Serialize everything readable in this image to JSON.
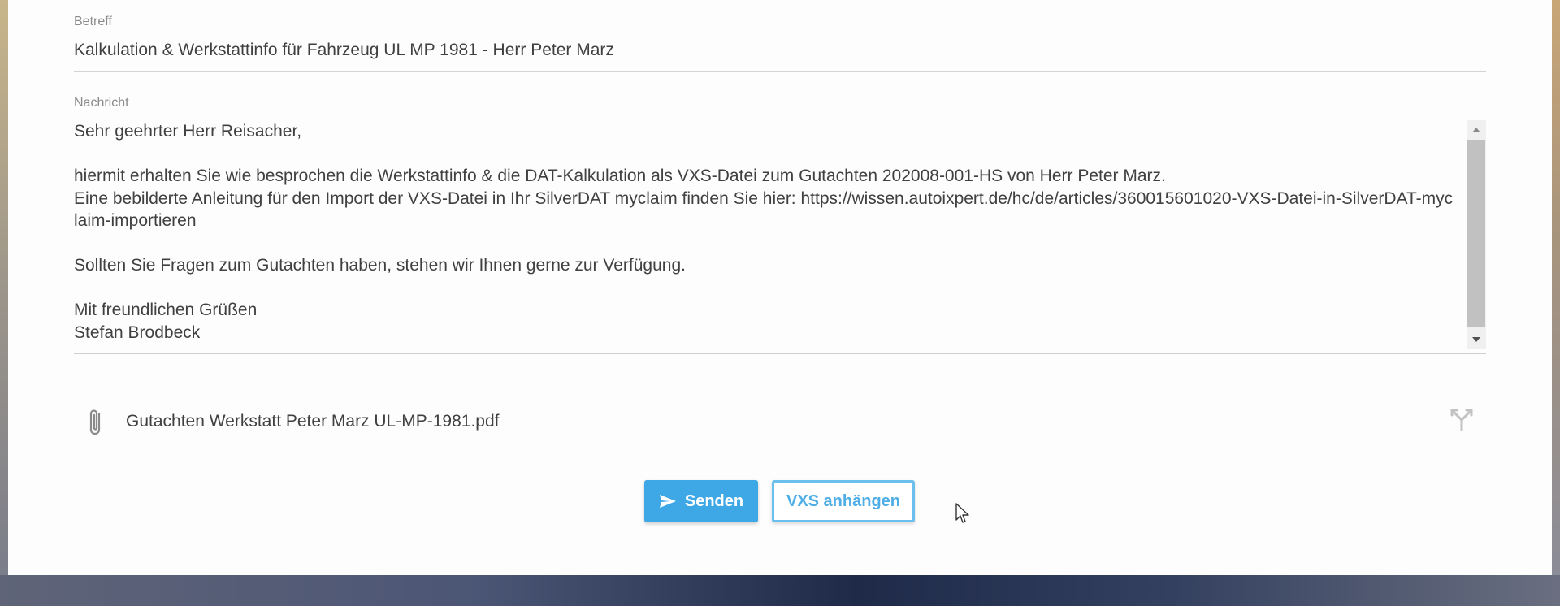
{
  "subject": {
    "label": "Betreff",
    "value": "Kalkulation & Werkstattinfo für Fahrzeug UL MP 1981 - Herr Peter Marz"
  },
  "message": {
    "label": "Nachricht",
    "body": "Sehr geehrter Herr Reisacher,\n\nhiermit erhalten Sie wie besprochen die Werkstattinfo & die DAT-Kalkulation als VXS-Datei zum Gutachten 202008-001-HS von Herr Peter Marz.\nEine bebilderte Anleitung für den Import der VXS-Datei in Ihr SilverDAT myclaim finden Sie hier: https://wissen.autoixpert.de/hc/de/articles/360015601020-VXS-Datei-in-SilverDAT-myclaim-importieren\n\nSollten Sie Fragen zum Gutachten haben, stehen wir Ihnen gerne zur Verfügung.\n\nMit freundlichen Grüßen\nStefan Brodbeck"
  },
  "attachment": {
    "icon": "paperclip-icon",
    "filename": "Gutachten Werkstatt Peter Marz UL-MP-1981.pdf",
    "action_icon": "split-icon"
  },
  "actions": {
    "send_label": "Senden",
    "send_icon": "send-icon",
    "vxs_label": "VXS anhängen"
  },
  "colors": {
    "primary": "#3ea7e6",
    "outline": "#6cc0ee",
    "text": "#404040",
    "label": "#8a8a8a"
  }
}
